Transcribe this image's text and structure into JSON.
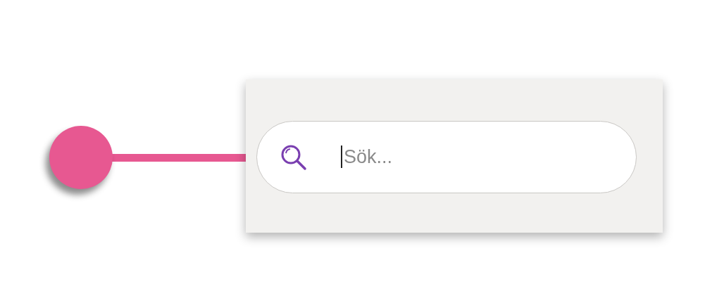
{
  "search": {
    "placeholder": "Sök..."
  }
}
